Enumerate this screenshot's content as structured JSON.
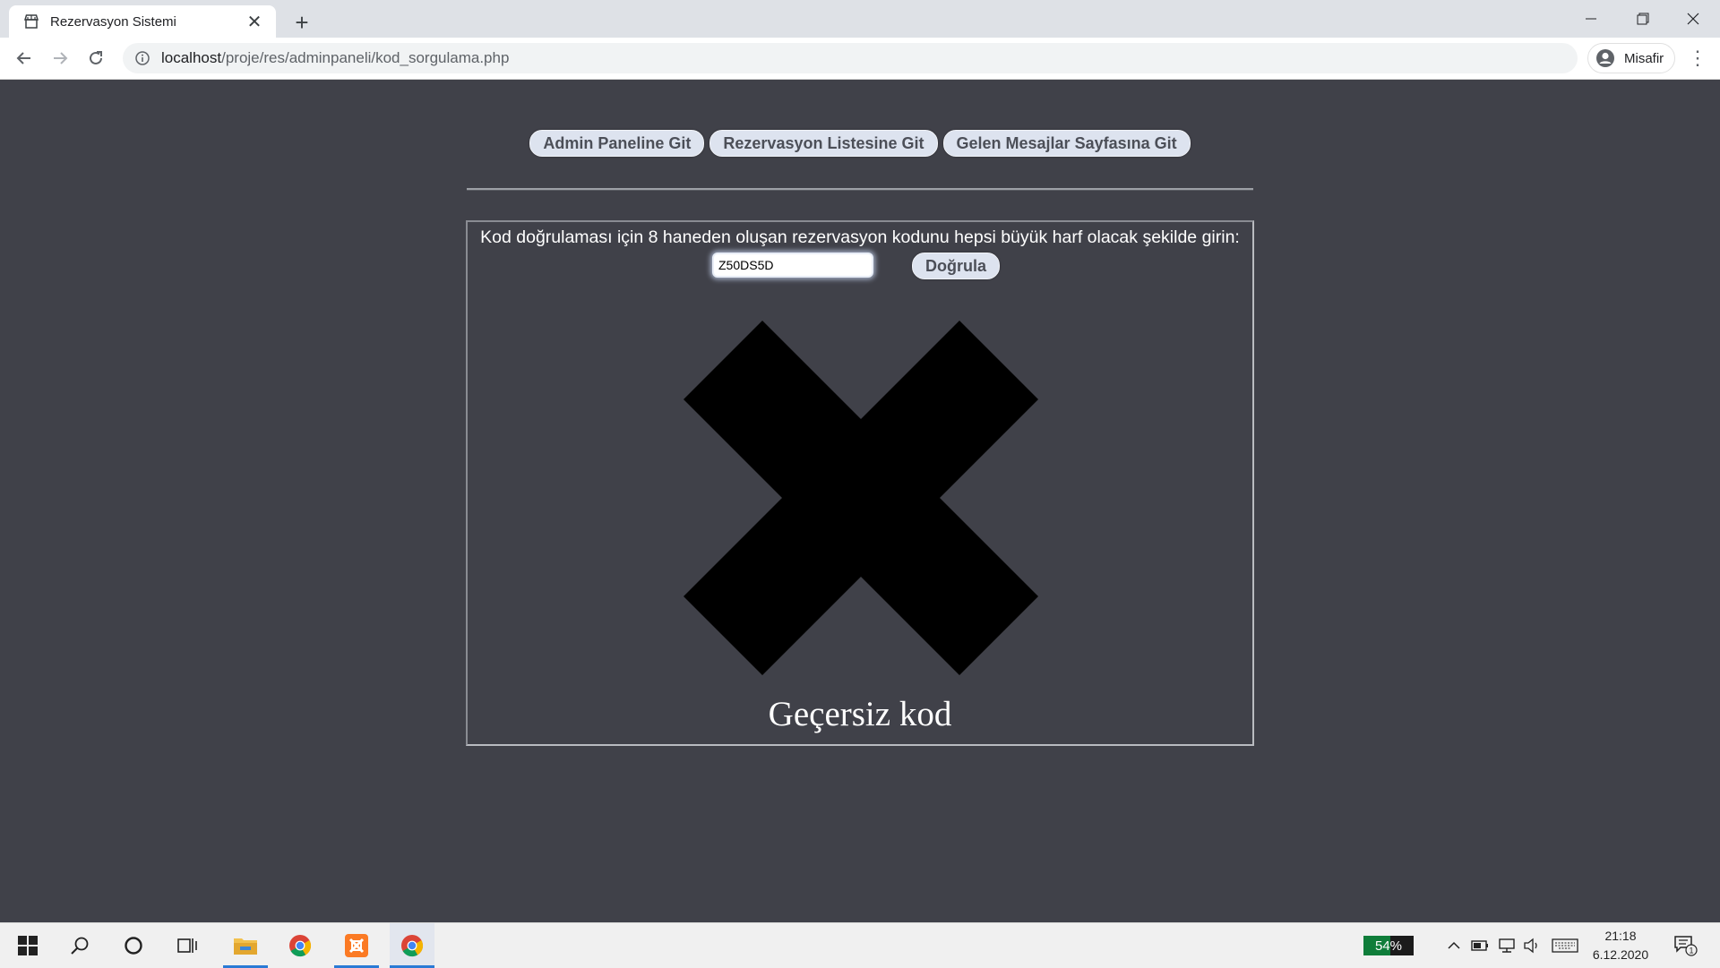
{
  "browser": {
    "tab_title": "Rezervasyon Sistemi",
    "url_host": "localhost",
    "url_path": "/proje/res/adminpaneli/kod_sorgulama.php",
    "profile_name": "Misafir"
  },
  "page": {
    "nav_buttons": [
      "Admin Paneline Git",
      "Rezervasyon Listesine Git",
      "Gelen Mesajlar Sayfasına Git"
    ],
    "prompt": "Kod doğrulaması için 8 haneden oluşan rezervasyon kodunu hepsi büyük harf olacak şekilde girin:",
    "code_value": "Z50DS5D",
    "verify_label": "Doğrula",
    "result_text": "Geçersiz kod",
    "result_icon": "x-mark-icon"
  },
  "taskbar": {
    "battery_percent": "54%",
    "battery_level": 0.54,
    "time": "21:18",
    "date": "6.12.2020",
    "notification_count": "1"
  },
  "colors": {
    "page_background": "#404149",
    "button_background": "#dde3ef",
    "button_text": "#4c4f58"
  }
}
